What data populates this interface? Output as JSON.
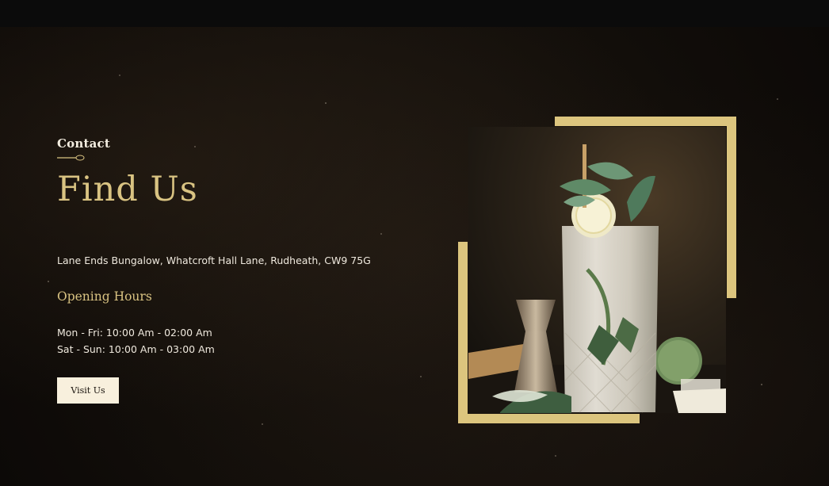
{
  "contact": {
    "eyebrow": "Contact",
    "title": "Find Us",
    "address": "Lane Ends Bungalow, Whatcroft Hall Lane, Rudheath, CW9 75G",
    "hours_title": "Opening Hours",
    "hours": [
      "Mon - Fri: 10:00 Am - 02:00 Am",
      "Sat - Sun: 10:00 Am - 03:00 Am"
    ],
    "button_label": "Visit Us"
  },
  "colors": {
    "accent_gold": "#d9c382",
    "frame_gold": "#dcc57e",
    "button_bg": "#f8f0dd",
    "background": "#120e0a"
  },
  "image": {
    "subject": "cocktail-glass-with-mint-and-lemon"
  }
}
